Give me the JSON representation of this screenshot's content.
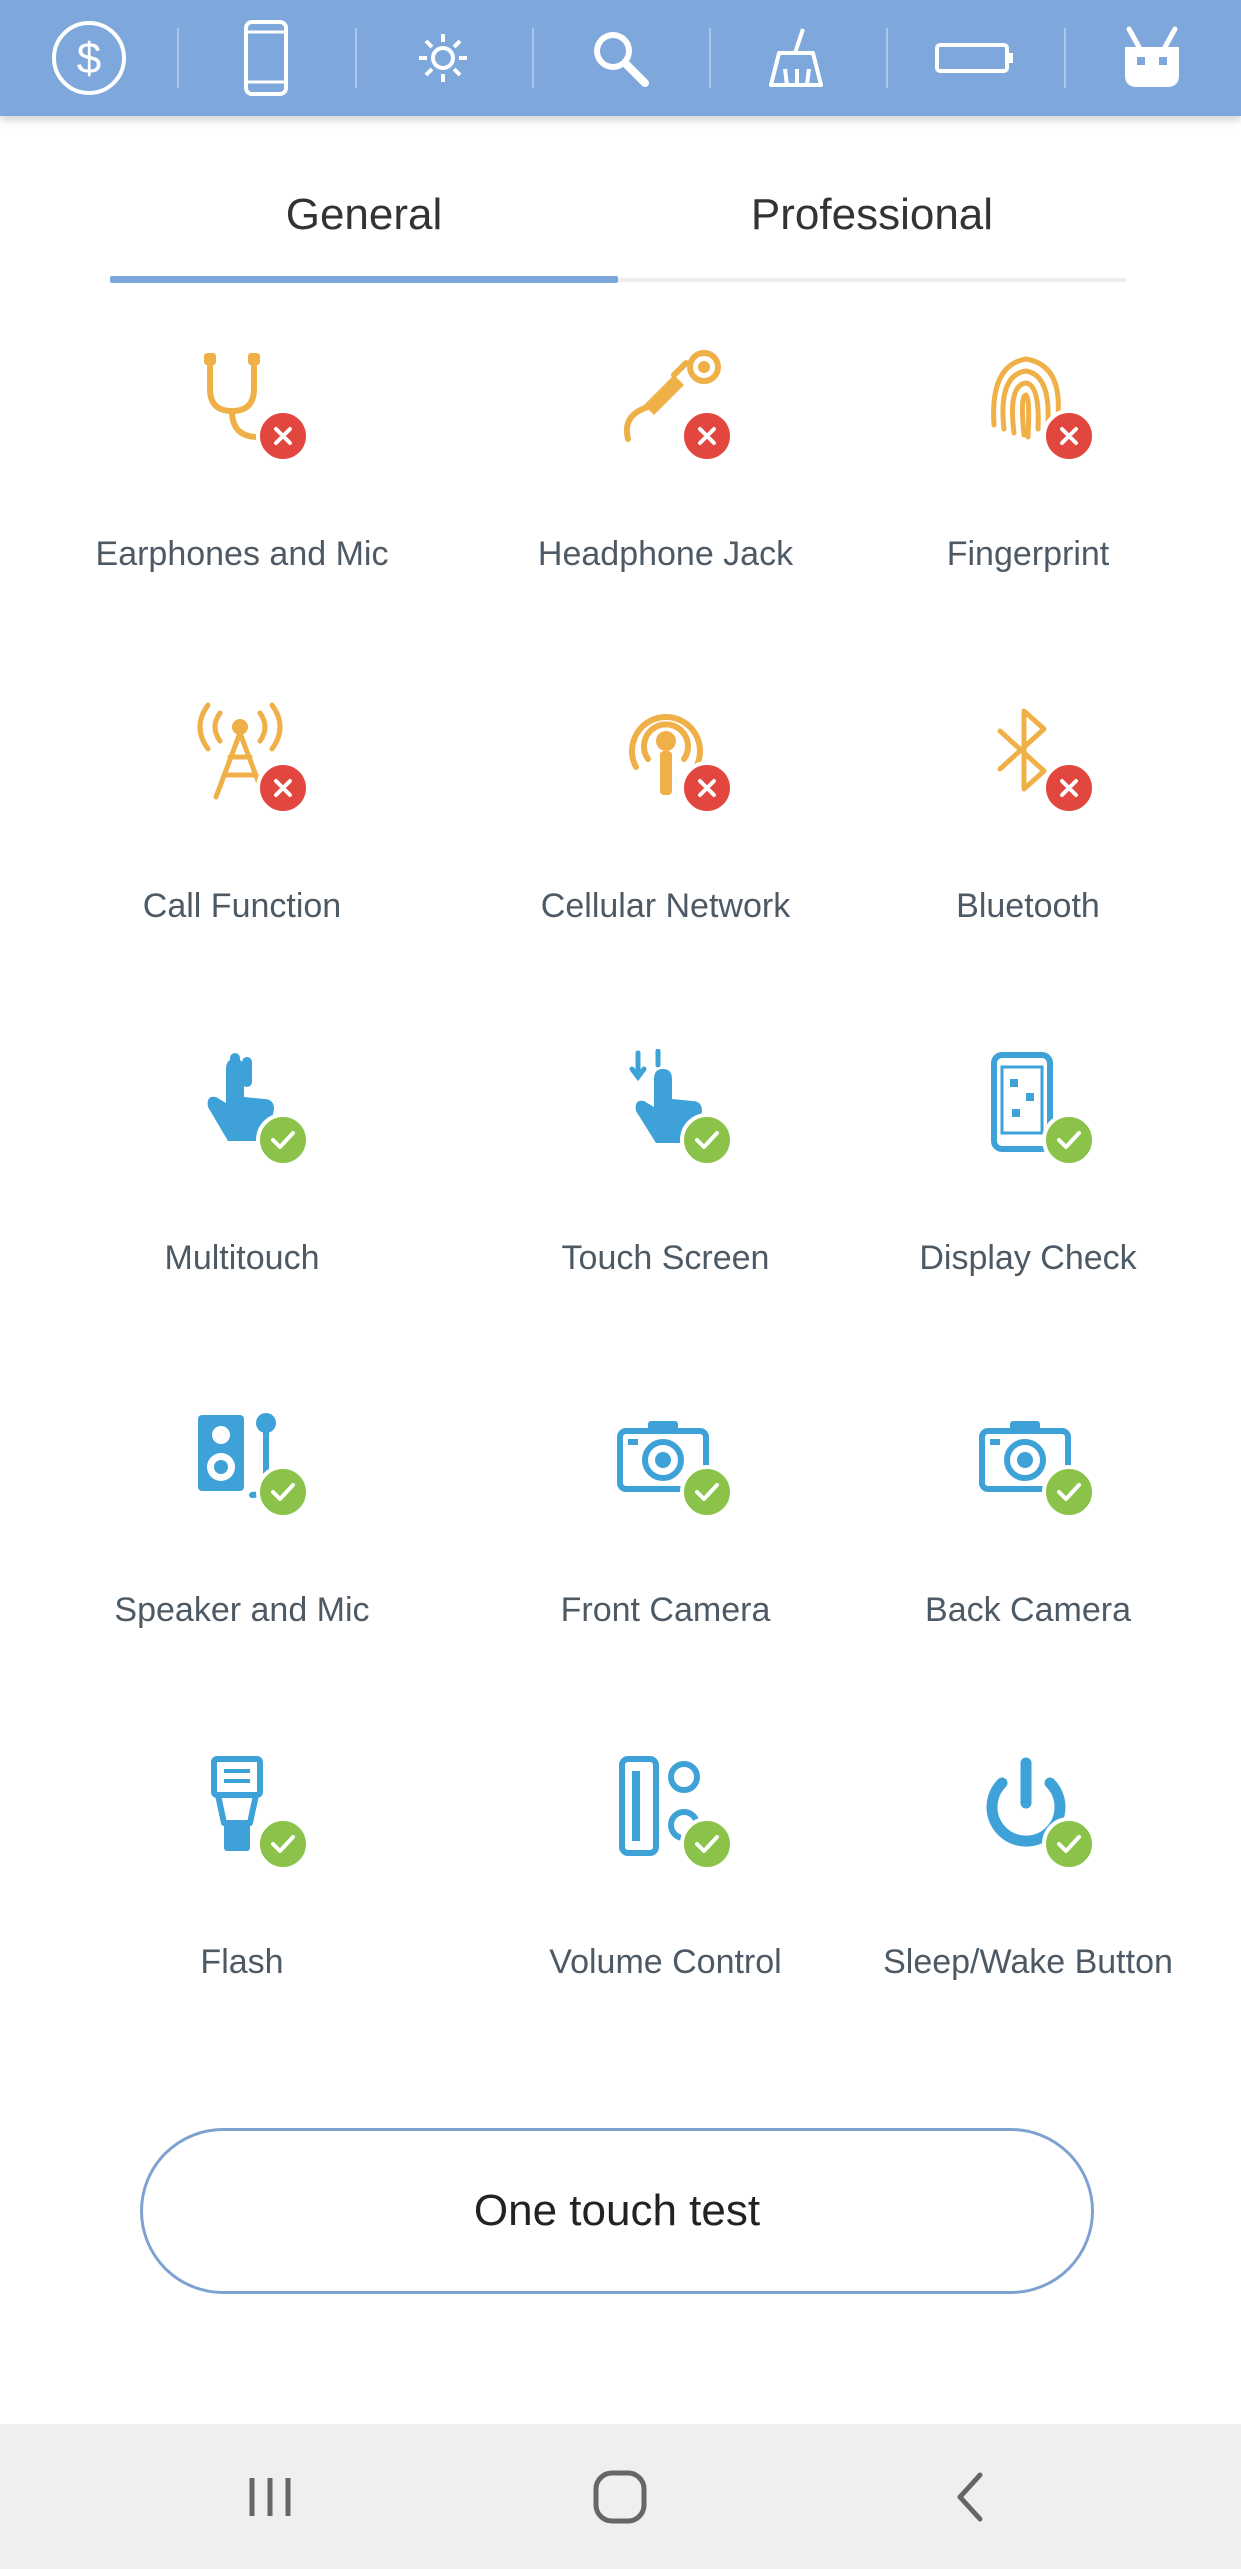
{
  "toolbar": {
    "icons": [
      "dollar-icon",
      "phone-icon",
      "gear-icon",
      "search-icon",
      "broom-icon",
      "battery-icon",
      "robot-icon"
    ]
  },
  "tabs": [
    {
      "label": "General",
      "active": true
    },
    {
      "label": "Professional",
      "active": false
    }
  ],
  "tests": [
    {
      "label": "Earphones and Mic",
      "status": "fail",
      "icon": "earphones-icon"
    },
    {
      "label": "Headphone Jack",
      "status": "fail",
      "icon": "headphone-jack-icon"
    },
    {
      "label": "Fingerprint",
      "status": "fail",
      "icon": "fingerprint-icon"
    },
    {
      "label": "Call Function",
      "status": "fail",
      "icon": "antenna-icon"
    },
    {
      "label": "Cellular Network",
      "status": "fail",
      "icon": "cellular-icon"
    },
    {
      "label": "Bluetooth",
      "status": "fail",
      "icon": "bluetooth-icon"
    },
    {
      "label": "Multitouch",
      "status": "pass",
      "icon": "multitouch-icon"
    },
    {
      "label": "Touch Screen",
      "status": "pass",
      "icon": "touch-screen-icon"
    },
    {
      "label": "Display Check",
      "status": "pass",
      "icon": "display-icon"
    },
    {
      "label": "Speaker and Mic",
      "status": "pass",
      "icon": "speaker-mic-icon"
    },
    {
      "label": "Front Camera",
      "status": "pass",
      "icon": "camera-icon"
    },
    {
      "label": "Back Camera",
      "status": "pass",
      "icon": "camera-icon"
    },
    {
      "label": "Flash",
      "status": "pass",
      "icon": "flash-icon"
    },
    {
      "label": "Volume Control",
      "status": "pass",
      "icon": "volume-icon"
    },
    {
      "label": "Sleep/Wake Button",
      "status": "pass",
      "icon": "power-icon"
    }
  ],
  "one_touch_label": "One touch test",
  "colors": {
    "toolbar": "#7ea8dc",
    "fail_icon": "#f0b048",
    "pass_icon": "#3ea2d8",
    "fail_badge": "#e2473f",
    "pass_badge": "#8bc34a",
    "tab_indicator": "#7aa6dc"
  },
  "nav": [
    "recents-icon",
    "home-icon",
    "back-icon"
  ]
}
